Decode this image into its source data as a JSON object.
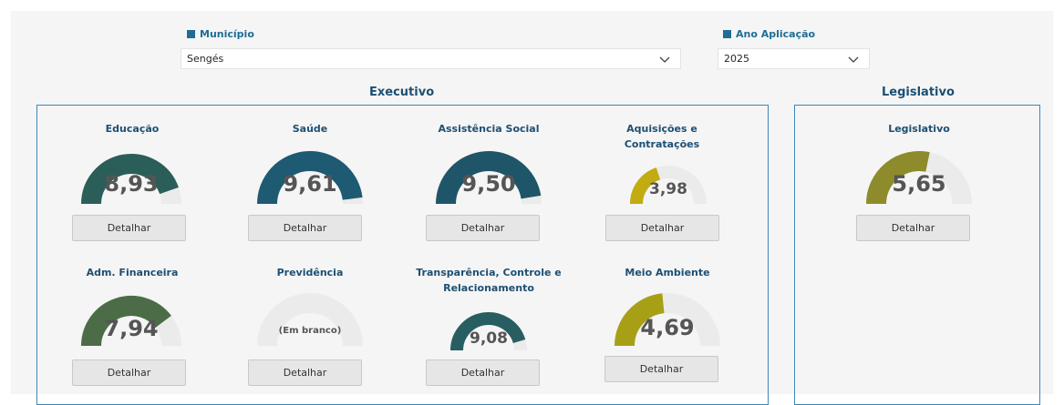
{
  "filters": {
    "municipio": {
      "label": "Município",
      "value": "Sengés"
    },
    "ano": {
      "label": "Ano Aplicação",
      "value": "2025"
    }
  },
  "sections": {
    "executivo": "Executivo",
    "legislativo": "Legislativo"
  },
  "button_label": "Detalhar",
  "gauges": [
    {
      "id": "educacao",
      "title": "Educação",
      "value": "8,93",
      "fill": 0.893,
      "color": "#2c5e59"
    },
    {
      "id": "saude",
      "title": "Saúde",
      "value": "9,61",
      "fill": 0.961,
      "color": "#1e5a72"
    },
    {
      "id": "assistencia",
      "title": "Assistência Social",
      "value": "9,50",
      "fill": 0.95,
      "color": "#1f5568"
    },
    {
      "id": "aquisicoes",
      "title": "Aquisições e\nContratações",
      "value": "3,98",
      "fill": 0.398,
      "color": "#c3ab12"
    },
    {
      "id": "adm-financeira",
      "title": "Adm. Financeira",
      "value": "7,94",
      "fill": 0.794,
      "color": "#4b6c47"
    },
    {
      "id": "previdencia",
      "title": "Previdência",
      "value": "(Em branco)",
      "fill": 0,
      "color": "#cccccc"
    },
    {
      "id": "transparencia",
      "title": "Transparência, Controle e\nRelacionamento",
      "value": "9,08",
      "fill": 0.908,
      "color": "#285e61"
    },
    {
      "id": "meio-ambiente",
      "title": "Meio Ambiente",
      "value": "4,69",
      "fill": 0.469,
      "color": "#a7a017"
    },
    {
      "id": "legislativo",
      "title": "Legislativo",
      "value": "5,65",
      "fill": 0.565,
      "color": "#8d8b2b"
    }
  ]
}
